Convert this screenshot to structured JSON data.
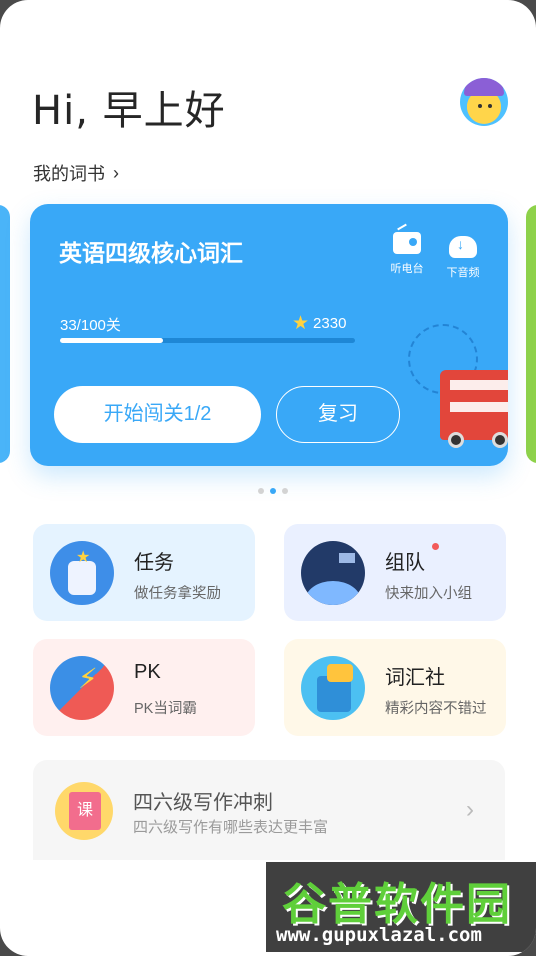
{
  "header": {
    "greeting": "Hi, 早上好",
    "wordbook_label": "我的词书",
    "wordbook_chevron": "›"
  },
  "card": {
    "title": "英语四级核心词汇",
    "radio_label": "听电台",
    "download_label": "下音频",
    "progress_text": "33/100关",
    "progress_fraction": 0.35,
    "stars": "2330",
    "start_button": "开始闯关1/2",
    "review_button": "复习"
  },
  "carousel": {
    "pages": 3,
    "active_index": 1
  },
  "tiles": [
    {
      "title": "任务",
      "subtitle": "做任务拿奖励",
      "bg": "#e5f3ff",
      "icon": "task-jar-icon"
    },
    {
      "title": "组队",
      "subtitle": "快来加入小组",
      "bg": "#eaf0ff",
      "icon": "team-moon-icon"
    },
    {
      "title": "PK",
      "subtitle": "PK当词霸",
      "bg": "#fff0ef",
      "icon": "pk-boxing-icon"
    },
    {
      "title": "词汇社",
      "subtitle": "精彩内容不错过",
      "bg": "#fff8e8",
      "icon": "vocab-club-icon"
    }
  ],
  "banner": {
    "icon_text": "课",
    "title": "四六级写作冲刺",
    "subtitle": "四六级写作有哪些表达更丰富",
    "chevron": "›"
  },
  "watermark": {
    "title": "谷普软件园",
    "url": "www.gupuxlazal.com"
  },
  "colors": {
    "accent": "#39a8f7",
    "tile_task": "#e5f3ff",
    "tile_team": "#eaf0ff",
    "tile_pk": "#fff0ef",
    "tile_vocab": "#fff8e8"
  }
}
